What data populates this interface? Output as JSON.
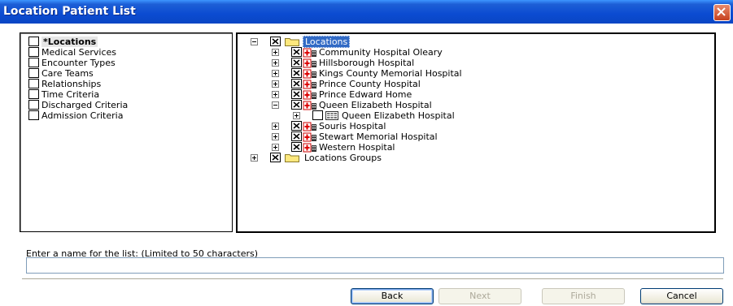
{
  "window": {
    "title": "Location Patient List"
  },
  "criteria_list": {
    "items": [
      {
        "label": "*Locations",
        "bold": true
      },
      {
        "label": "Medical Services"
      },
      {
        "label": "Encounter Types"
      },
      {
        "label": "Care Teams"
      },
      {
        "label": "Relationships"
      },
      {
        "label": "Time Criteria"
      },
      {
        "label": "Discharged Criteria"
      },
      {
        "label": "Admission Criteria"
      }
    ]
  },
  "tree": {
    "root": {
      "label": "Locations",
      "checked": true,
      "expanded": true,
      "selected": true
    },
    "facilities": [
      {
        "label": "Community Hospital Oleary",
        "checked": true
      },
      {
        "label": "Hillsborough Hospital",
        "checked": true
      },
      {
        "label": "Kings County Memorial Hospital",
        "checked": true
      },
      {
        "label": "Prince County Hospital",
        "checked": true
      },
      {
        "label": "Prince Edward Home",
        "checked": true
      },
      {
        "label": "Queen Elizabeth Hospital",
        "checked": true,
        "expanded": true
      },
      {
        "label": "Queen Elizabeth Hospital",
        "checked": false
      },
      {
        "label": "Souris Hospital",
        "checked": true
      },
      {
        "label": "Stewart Memorial Hospital",
        "checked": true
      },
      {
        "label": "Western Hospital",
        "checked": true
      }
    ],
    "groups": {
      "label": "Locations Groups",
      "checked": true
    }
  },
  "name_field": {
    "label": "Enter a name for the list: (Limited to 50 characters)",
    "value": ""
  },
  "buttons": {
    "back": "Back",
    "next": "Next",
    "finish": "Finish",
    "cancel": "Cancel"
  },
  "icons": [
    "close-icon",
    "folder-icon",
    "hospital-icon",
    "nurse-unit-icon",
    "checkbox-x-icon"
  ]
}
